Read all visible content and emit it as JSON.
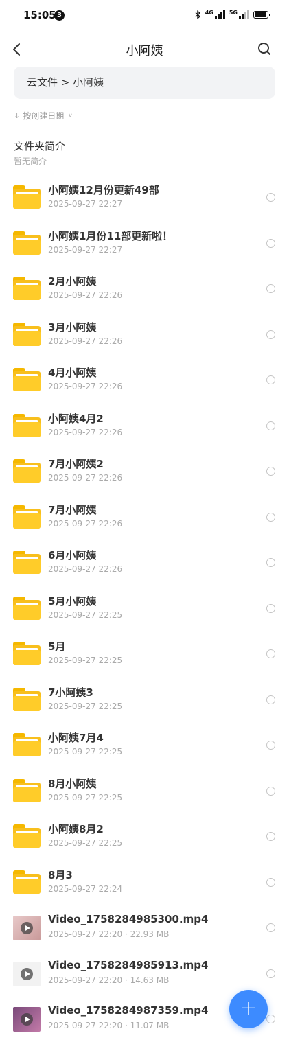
{
  "status_bar": {
    "time": "15:05",
    "notification_count": "3",
    "network_1": "4G",
    "network_2": "5G"
  },
  "header": {
    "title": "小阿姨"
  },
  "breadcrumb": {
    "text": "云文件 > 小阿姨"
  },
  "sort": {
    "label": "按创建日期"
  },
  "intro": {
    "title": "文件夹简介",
    "subtitle": "暂无简介"
  },
  "items": [
    {
      "name": "小阿姨12月份更新49部",
      "meta": "2025-09-27 22:27",
      "type": "folder"
    },
    {
      "name": "小阿姨1月份11部更新啦！",
      "meta": "2025-09-27 22:27",
      "type": "folder"
    },
    {
      "name": "2月小阿姨",
      "meta": "2025-09-27 22:26",
      "type": "folder"
    },
    {
      "name": "3月小阿姨",
      "meta": "2025-09-27 22:26",
      "type": "folder"
    },
    {
      "name": "4月小阿姨",
      "meta": "2025-09-27 22:26",
      "type": "folder"
    },
    {
      "name": "小阿姨4月2",
      "meta": "2025-09-27 22:26",
      "type": "folder"
    },
    {
      "name": "7月小阿姨2",
      "meta": "2025-09-27 22:26",
      "type": "folder"
    },
    {
      "name": "7月小阿姨",
      "meta": "2025-09-27 22:26",
      "type": "folder"
    },
    {
      "name": "6月小阿姨",
      "meta": "2025-09-27 22:26",
      "type": "folder"
    },
    {
      "name": "5月小阿姨",
      "meta": "2025-09-27 22:25",
      "type": "folder"
    },
    {
      "name": "5月",
      "meta": "2025-09-27 22:25",
      "type": "folder"
    },
    {
      "name": "7小阿姨3",
      "meta": "2025-09-27 22:25",
      "type": "folder"
    },
    {
      "name": "小阿姨7月4",
      "meta": "2025-09-27 22:25",
      "type": "folder"
    },
    {
      "name": "8月小阿姨",
      "meta": "2025-09-27 22:25",
      "type": "folder"
    },
    {
      "name": "小阿姨8月2",
      "meta": "2025-09-27 22:25",
      "type": "folder"
    },
    {
      "name": "8月3",
      "meta": "2025-09-27 22:24",
      "type": "folder"
    },
    {
      "name": "Video_1758284985300.mp4",
      "meta": "2025-09-27 22:20 · 22.93 MB",
      "type": "video",
      "thumb": "#d9b8b8"
    },
    {
      "name": "Video_1758284985913.mp4",
      "meta": "2025-09-27 22:20 · 14.63 MB",
      "type": "video",
      "thumb": "#f0f0f0"
    },
    {
      "name": "Video_1758284987359.mp4",
      "meta": "2025-09-27 22:20 · 11.07 MB",
      "type": "video",
      "thumb": "#b06a9a"
    }
  ],
  "fab": {
    "label": "+"
  },
  "colors": {
    "folder": "#ffcc29",
    "accent": "#3d8bff",
    "breadcrumb_bg": "#f2f3f5"
  }
}
